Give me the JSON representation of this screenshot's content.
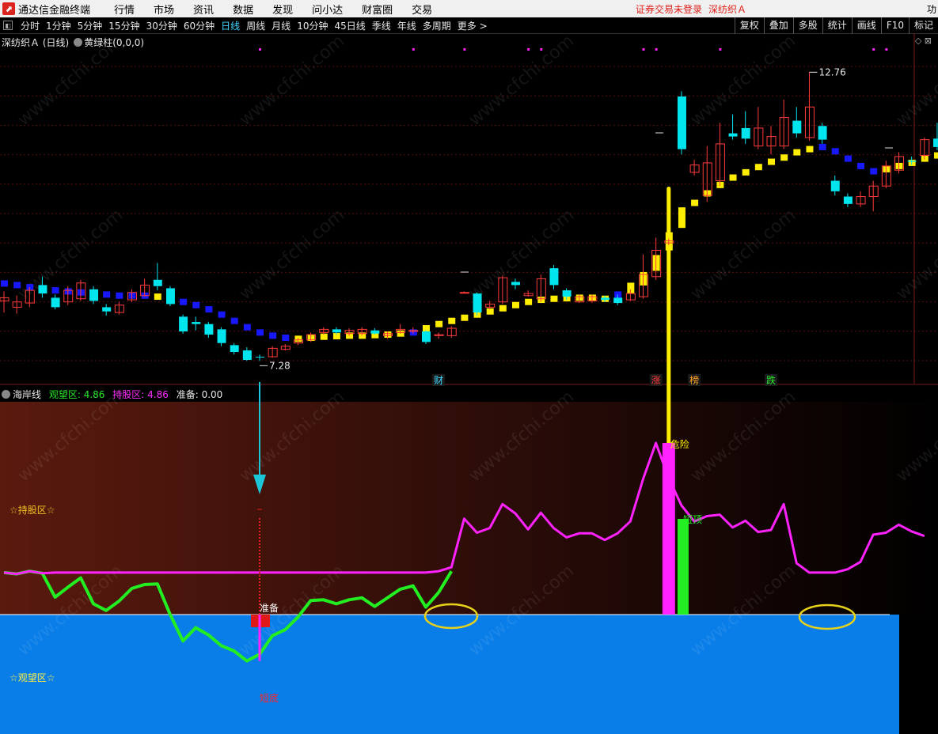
{
  "menubar": {
    "app_title": "通达信金融终端",
    "items": [
      "行情",
      "市场",
      "资讯",
      "数据",
      "发现",
      "问小达",
      "财富圈",
      "交易"
    ],
    "login_status": "证券交易未登录",
    "stock_label": "深纺织Ａ",
    "overflow": "功"
  },
  "toolbar": {
    "periods": [
      "分时",
      "1分钟",
      "5分钟",
      "15分钟",
      "30分钟",
      "60分钟",
      "日线",
      "周线",
      "月线",
      "10分钟",
      "45日线",
      "季线",
      "年线",
      "多周期",
      "更多 >"
    ],
    "active_period": "日线",
    "right_buttons": [
      "复权",
      "叠加",
      "多股",
      "统计",
      "画线",
      "F10",
      "标记"
    ]
  },
  "main_header": {
    "stock": "深纺织Ａ (日线)",
    "indicator": "黄绿柱(0,0,0)"
  },
  "indicator_header": {
    "name": "海岸线",
    "watch_label": "观望区:",
    "watch_value": "4.86",
    "hold_label": "持股区:",
    "hold_value": "4.86",
    "ready_label": "准备:",
    "ready_value": "0.00"
  },
  "colors": {
    "up": "#ff3b3b",
    "down": "#00e5ee",
    "yellow_bar": "#ffee00",
    "blue_bar": "#1818ff",
    "magenta": "#ff22ff",
    "green": "#22ee22",
    "watch_zone": "#0a7ee8"
  },
  "chart_data": [
    {
      "type": "candlestick",
      "title": "深纺织Ａ (日线)",
      "price_high_label": "12.76",
      "price_low_label": "7.28",
      "ylim": [
        7.0,
        13.2
      ],
      "candles": [
        [
          8.42,
          8.48,
          8.2,
          8.6
        ],
        [
          8.3,
          8.4,
          8.18,
          8.52
        ],
        [
          8.38,
          8.62,
          8.3,
          8.68
        ],
        [
          8.72,
          8.56,
          8.48,
          8.88
        ],
        [
          8.48,
          8.3,
          8.26,
          8.54
        ],
        [
          8.4,
          8.62,
          8.34,
          8.7
        ],
        [
          8.46,
          8.76,
          8.42,
          8.82
        ],
        [
          8.64,
          8.42,
          8.36,
          8.7
        ],
        [
          8.3,
          8.22,
          8.14,
          8.36
        ],
        [
          8.2,
          8.34,
          8.16,
          8.4
        ],
        [
          8.44,
          8.58,
          8.4,
          8.64
        ],
        [
          8.52,
          8.72,
          8.5,
          8.84
        ],
        [
          8.82,
          8.7,
          8.62,
          9.14
        ],
        [
          8.66,
          8.36,
          8.32,
          8.7
        ],
        [
          8.12,
          7.84,
          7.8,
          8.16
        ],
        [
          8.02,
          7.98,
          7.86,
          8.12
        ],
        [
          7.98,
          7.78,
          7.72,
          8.02
        ],
        [
          7.88,
          7.62,
          7.56,
          7.92
        ],
        [
          7.58,
          7.45,
          7.4,
          7.62
        ],
        [
          7.48,
          7.3,
          7.28,
          7.54
        ],
        [
          7.36,
          7.35,
          7.28,
          7.4
        ],
        [
          7.36,
          7.52,
          7.34,
          7.56
        ],
        [
          7.5,
          7.56,
          7.48,
          7.6
        ],
        [
          7.62,
          7.68,
          7.58,
          7.72
        ],
        [
          7.68,
          7.78,
          7.64,
          7.82
        ],
        [
          7.82,
          7.88,
          7.78,
          7.92
        ],
        [
          7.88,
          7.82,
          7.78,
          7.92
        ],
        [
          7.8,
          7.86,
          7.76,
          7.9
        ],
        [
          7.8,
          7.88,
          7.76,
          7.92
        ],
        [
          7.86,
          7.8,
          7.78,
          7.9
        ],
        [
          7.76,
          7.8,
          7.7,
          7.84
        ],
        [
          7.82,
          7.88,
          7.8,
          7.98
        ],
        [
          7.84,
          7.86,
          7.8,
          7.92
        ],
        [
          7.84,
          7.64,
          7.6,
          7.86
        ],
        [
          7.76,
          7.78,
          7.7,
          7.82
        ],
        [
          7.76,
          7.9,
          7.72,
          7.94
        ],
        [
          8.58,
          8.58,
          8.56,
          8.6
        ],
        [
          8.56,
          8.2,
          8.14,
          8.58
        ],
        [
          8.3,
          8.36,
          8.26,
          8.42
        ],
        [
          8.4,
          8.86,
          8.36,
          8.9
        ],
        [
          8.78,
          8.72,
          8.64,
          8.84
        ],
        [
          8.52,
          8.56,
          8.5,
          8.62
        ],
        [
          8.46,
          8.84,
          8.4,
          8.92
        ],
        [
          9.04,
          8.72,
          8.64,
          9.1
        ],
        [
          8.62,
          8.5,
          8.44,
          8.66
        ],
        [
          8.4,
          8.5,
          8.38,
          8.54
        ],
        [
          8.42,
          8.5,
          8.38,
          8.54
        ],
        [
          8.48,
          8.44,
          8.4,
          8.52
        ],
        [
          8.48,
          8.38,
          8.34,
          8.54
        ],
        [
          8.44,
          8.56,
          8.42,
          8.64
        ],
        [
          8.5,
          8.92,
          8.46,
          9.3
        ],
        [
          8.88,
          9.38,
          8.82,
          9.62
        ],
        [
          9.52,
          9.56,
          9.48,
          9.6
        ],
        [
          12.3,
          11.3,
          11.2,
          12.4
        ],
        [
          10.86,
          11.0,
          10.8,
          11.1
        ],
        [
          10.42,
          11.04,
          10.3,
          11.36
        ],
        [
          10.7,
          11.4,
          10.6,
          11.8
        ],
        [
          11.6,
          11.54,
          11.48,
          11.96
        ],
        [
          11.7,
          11.5,
          11.4,
          12.02
        ],
        [
          11.36,
          11.7,
          11.3,
          12.1
        ],
        [
          11.36,
          11.54,
          11.2,
          11.74
        ],
        [
          11.36,
          11.9,
          11.3,
          12.24
        ],
        [
          11.84,
          11.6,
          11.52,
          12.1
        ],
        [
          11.52,
          12.1,
          11.46,
          12.76
        ],
        [
          11.74,
          11.48,
          11.4,
          11.8
        ],
        [
          10.7,
          10.5,
          10.42,
          10.8
        ],
        [
          10.4,
          10.26,
          10.2,
          10.46
        ],
        [
          10.26,
          10.4,
          10.2,
          10.5
        ],
        [
          10.4,
          10.6,
          10.12,
          10.7
        ],
        [
          10.6,
          10.98,
          10.56,
          11.08
        ],
        [
          10.9,
          11.16,
          10.84,
          11.24
        ],
        [
          11.08,
          11.06,
          11.0,
          11.16
        ],
        [
          11.18,
          11.48,
          11.1,
          11.52
        ],
        [
          11.5,
          11.34,
          11.28,
          11.8
        ],
        [
          11.42,
          11.42,
          11.4,
          11.44
        ]
      ],
      "trend_bars": {
        "colors": [
          "blue",
          "blue",
          "blue",
          "blue",
          "blue",
          "blue",
          "blue",
          "blue",
          "blue",
          "blue",
          "blue",
          "blue",
          "yellow",
          "blue",
          "blue",
          "blue",
          "blue",
          "blue",
          "blue",
          "blue",
          "blue",
          "blue",
          "blue",
          "yellow",
          "yellow",
          "yellow",
          "yellow",
          "yellow",
          "yellow",
          "yellow",
          "yellow",
          "yellow",
          "blue",
          "yellow",
          "yellow",
          "yellow",
          "yellow",
          "yellow",
          "yellow",
          "yellow",
          "yellow",
          "yellow",
          "yellow",
          "yellow",
          "yellow",
          "yellow",
          "yellow",
          "yellow",
          "blue",
          "yellow",
          "yellow",
          "yellow",
          "yellow",
          "yellow",
          "yellow",
          "yellow",
          "yellow",
          "yellow",
          "yellow",
          "yellow",
          "yellow",
          "yellow",
          "yellow",
          "yellow",
          "blue",
          "blue",
          "blue",
          "blue",
          "blue",
          "yellow",
          "yellow",
          "yellow",
          "yellow",
          "yellow"
        ],
        "values": [
          8.75,
          8.72,
          8.68,
          8.66,
          8.62,
          8.6,
          8.58,
          8.56,
          8.54,
          8.52,
          8.52,
          8.52,
          8.5,
          8.46,
          8.4,
          8.34,
          8.26,
          8.16,
          8.04,
          7.92,
          7.82,
          7.76,
          7.72,
          7.7,
          7.72,
          7.74,
          7.75,
          7.76,
          7.76,
          7.77,
          7.78,
          7.8,
          7.82,
          7.9,
          7.98,
          8.04,
          8.1,
          8.16,
          8.22,
          8.28,
          8.34,
          8.4,
          8.44,
          8.46,
          8.47,
          8.48,
          8.48,
          8.46,
          8.54,
          8.66,
          8.84,
          9.14,
          9.55,
          10.0,
          10.28,
          10.46,
          10.62,
          10.76,
          10.86,
          10.96,
          11.06,
          11.14,
          11.24,
          11.3,
          11.34,
          11.26,
          11.12,
          10.98,
          10.88,
          10.92,
          10.98,
          11.04,
          11.12,
          11.18
        ],
        "spike": {
          "index": 52,
          "from": 9.55,
          "to": 10.55
        }
      },
      "markers": [
        {
          "index": 34,
          "label": "财",
          "color": "#3fd8ff"
        },
        {
          "index": 51,
          "label": "涨",
          "color": "#ff3b3b"
        },
        {
          "index": 54,
          "label": "榜",
          "color": "#ffa020"
        },
        {
          "index": 60,
          "label": "跌",
          "color": "#29e829"
        }
      ]
    },
    {
      "type": "line",
      "title": "海岸线",
      "zones": {
        "hold": "☆持股区☆",
        "watch": "☆观望区☆"
      },
      "labels": {
        "ready": "准备",
        "bottom": "短底",
        "danger": "危险",
        "top": "短顶"
      },
      "ylim": [
        0,
        10
      ],
      "series": [
        {
          "name": "持股区",
          "color": "#ff22ff",
          "values": [
            4.86,
            4.82,
            4.9,
            4.84,
            4.86,
            4.86,
            4.86,
            4.86,
            4.86,
            4.86,
            4.86,
            4.86,
            4.86,
            4.86,
            4.86,
            4.86,
            4.86,
            4.86,
            4.86,
            4.86,
            4.86,
            4.86,
            4.86,
            4.86,
            4.86,
            4.86,
            4.86,
            4.86,
            4.86,
            4.86,
            4.86,
            4.86,
            4.86,
            4.86,
            4.9,
            5.02,
            6.48,
            6.06,
            6.2,
            6.92,
            6.64,
            6.16,
            6.66,
            6.2,
            5.92,
            6.04,
            6.04,
            5.84,
            6.04,
            6.4,
            7.68,
            8.76,
            7.7,
            6.88,
            6.4,
            6.56,
            6.6,
            6.22,
            6.42,
            6.08,
            6.14,
            6.92,
            5.14,
            4.86,
            4.86,
            4.86,
            4.96,
            5.18,
            6.0,
            6.06,
            6.3,
            6.1,
            5.96
          ]
        },
        {
          "name": "观望区",
          "color": "#22ee22",
          "values": [
            4.86,
            4.82,
            4.9,
            4.84,
            4.12,
            4.42,
            4.7,
            3.92,
            3.72,
            4.0,
            4.38,
            4.5,
            4.52,
            3.6,
            2.8,
            3.2,
            2.98,
            2.66,
            2.5,
            2.2,
            2.4,
            2.96,
            3.14,
            3.52,
            4.02,
            4.04,
            3.92,
            4.04,
            4.1,
            3.84,
            4.1,
            4.36,
            4.46,
            3.82,
            4.26,
            4.9
          ]
        }
      ]
    }
  ]
}
